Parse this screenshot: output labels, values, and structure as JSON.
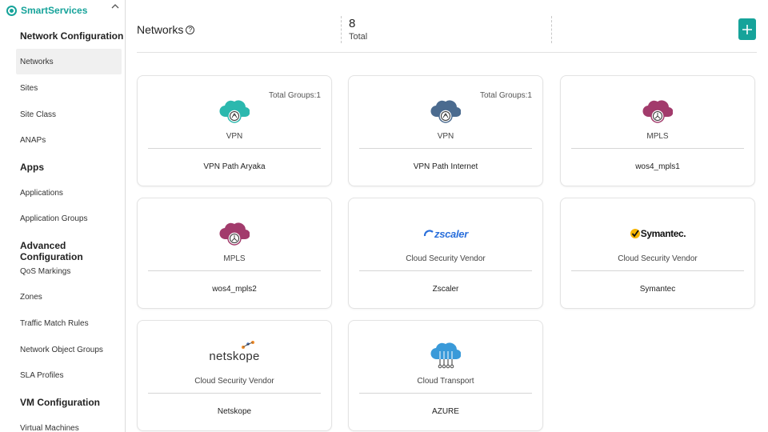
{
  "brand": {
    "name": "SmartServices",
    "logo_icon": "smartservices-logo-icon",
    "collapse_icon": "chevron-up-icon"
  },
  "sidebar": {
    "sections": [
      {
        "heading": "Network Configuration",
        "items": [
          "Networks",
          "Sites",
          "Site Class",
          "ANAPs"
        ]
      },
      {
        "heading": "Apps",
        "items": [
          "Applications",
          "Application Groups"
        ]
      },
      {
        "heading": "Advanced Configuration",
        "items": [
          "QoS Markings",
          "Zones",
          "Traffic Match Rules",
          "Network Object Groups",
          "SLA Profiles"
        ]
      },
      {
        "heading": "VM Configuration",
        "items": [
          "Virtual Machines"
        ]
      }
    ],
    "active_item": "Networks"
  },
  "header": {
    "title": "Networks",
    "help_icon": "help-circle-icon",
    "total_count": "8",
    "total_label": "Total",
    "add_icon": "plus-icon"
  },
  "colors": {
    "accent": "#16a39a",
    "vpn_aryaka": "#2bb8ae",
    "vpn_internet": "#4b6b8f",
    "mpls": "#a23b6c",
    "azure": "#3a9ad9"
  },
  "cards": [
    {
      "groups": "Total Groups:1",
      "logo": "vpn-cloud-icon",
      "type": "VPN",
      "name": "VPN Path Aryaka"
    },
    {
      "groups": "Total Groups:1",
      "logo": "vpn-cloud-icon",
      "type": "VPN",
      "name": "VPN Path Internet"
    },
    {
      "groups": "",
      "logo": "mpls-cloud-icon",
      "type": "MPLS",
      "name": "wos4_mpls1"
    },
    {
      "groups": "",
      "logo": "mpls-cloud-icon",
      "type": "MPLS",
      "name": "wos4_mpls2"
    },
    {
      "groups": "",
      "logo": "zscaler-logo",
      "logo_text": "zscaler",
      "type": "Cloud Security Vendor",
      "name": "Zscaler"
    },
    {
      "groups": "",
      "logo": "symantec-logo",
      "logo_text": "Symantec.",
      "type": "Cloud Security Vendor",
      "name": "Symantec"
    },
    {
      "groups": "",
      "logo": "netskope-logo",
      "logo_text": "netskope",
      "type": "Cloud Security Vendor",
      "name": "Netskope"
    },
    {
      "groups": "",
      "logo": "azure-cloud-icon",
      "type": "Cloud Transport",
      "name": "AZURE"
    }
  ]
}
